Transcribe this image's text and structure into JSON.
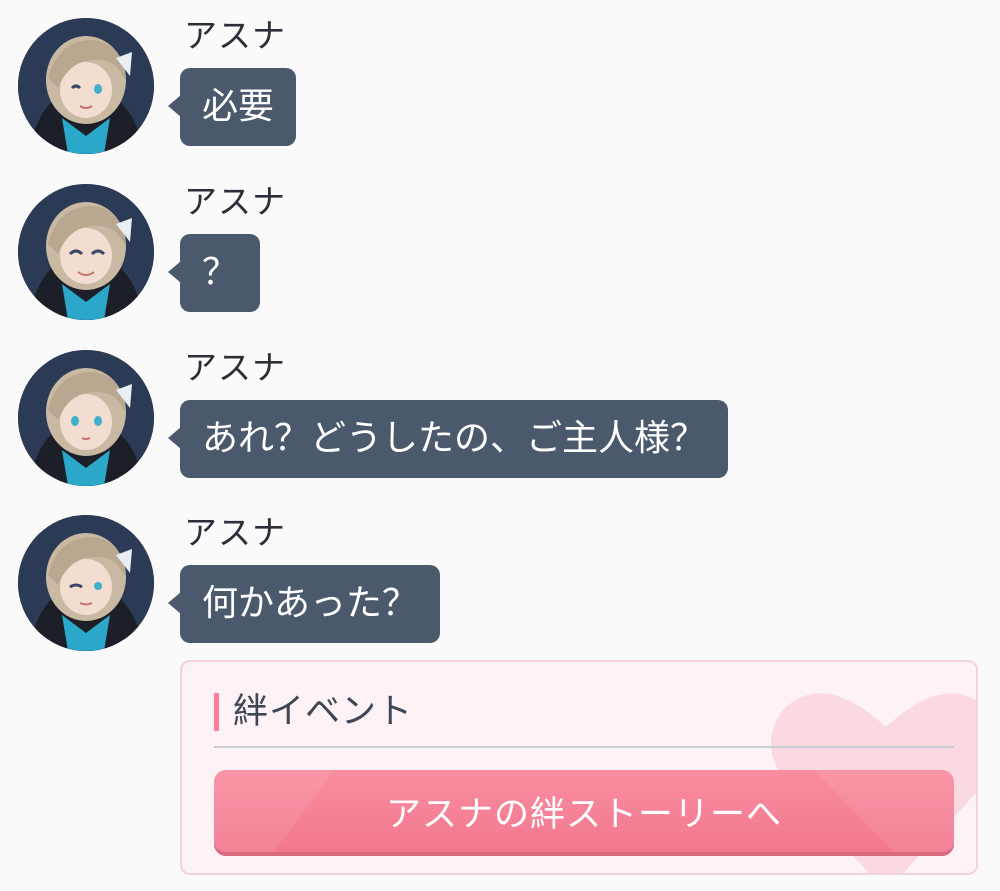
{
  "messages": [
    {
      "sender": "アスナ",
      "text": "必要"
    },
    {
      "sender": "アスナ",
      "text": "？"
    },
    {
      "sender": "アスナ",
      "text": "あれ？どうしたの、ご主人様？"
    },
    {
      "sender": "アスナ",
      "text": "何かあった？"
    }
  ],
  "bond_event": {
    "title": "絆イベント",
    "button_label": "アスナの絆ストーリーへ"
  },
  "colors": {
    "bubble": "#4b596c",
    "accent": "#ff7d97",
    "button": "#f2788f",
    "card_bg": "#fdf2f5"
  },
  "icons": {
    "avatar": "character-portrait-icon",
    "bond_accent": "accent-bar",
    "heart": "heart-icon"
  }
}
